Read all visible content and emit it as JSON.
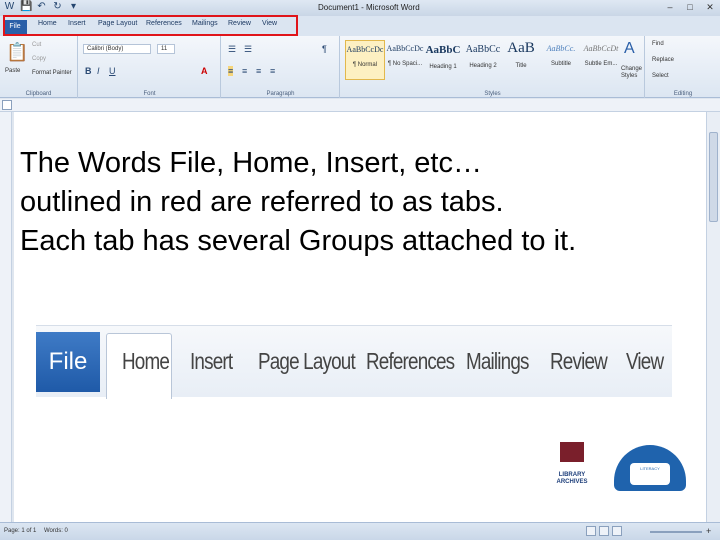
{
  "window": {
    "title": "Document1 - Microsoft Word",
    "controls": [
      "–",
      "□",
      "✕"
    ]
  },
  "quick_access": [
    "W",
    "💾",
    "↶",
    "↻",
    "▾"
  ],
  "tabs": [
    "File",
    "Home",
    "Insert",
    "Page Layout",
    "References",
    "Mailings",
    "Review",
    "View"
  ],
  "ribbon": {
    "clipboard": {
      "label": "Clipboard",
      "paste": "Paste",
      "cut": "Cut",
      "copy": "Copy",
      "format_painter": "Format Painter"
    },
    "font": {
      "label": "Font",
      "font_name": "Calibri (Body)",
      "font_size": "11"
    },
    "paragraph": {
      "label": "Paragraph"
    },
    "styles": {
      "label": "Styles",
      "items": [
        {
          "sample": "AaBbCcDc",
          "name": "¶ Normal"
        },
        {
          "sample": "AaBbCcDc",
          "name": "¶ No Spaci..."
        },
        {
          "sample": "AaBbC",
          "name": "Heading 1"
        },
        {
          "sample": "AaBbCc",
          "name": "Heading 2"
        },
        {
          "sample": "AaB",
          "name": "Title"
        },
        {
          "sample": "AaBbCc.",
          "name": "Subtitle"
        },
        {
          "sample": "AaBbCcDt",
          "name": "Subtle Em..."
        }
      ],
      "change_styles": "Change Styles"
    },
    "editing": {
      "label": "Editing",
      "find": "Find",
      "replace": "Replace",
      "select": "Select"
    }
  },
  "slide_text": [
    "The Words File, Home, Insert, etc…",
    "outlined in red are referred to as tabs.",
    "Each tab has several Groups attached to it."
  ],
  "zoomed_tabs": [
    "File",
    "Home",
    "Insert",
    "Page Layout",
    "References",
    "Mailings",
    "Review",
    "View"
  ],
  "logos": {
    "library": "LIBRARY ARCHIVES",
    "round": "LITERACY"
  },
  "status": {
    "page": "Page: 1 of 1",
    "words": "Words: 0"
  },
  "colors": {
    "outline": "#e0141a",
    "file_tab": "#2a5fa8"
  }
}
